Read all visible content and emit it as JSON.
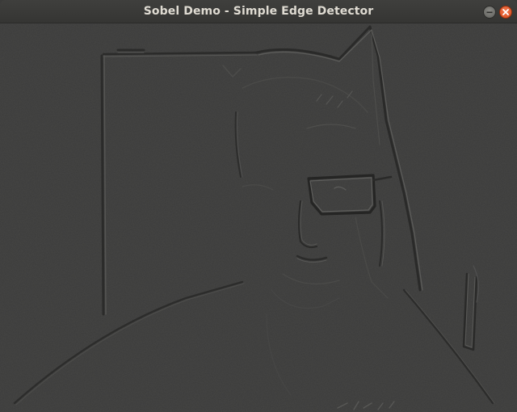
{
  "window": {
    "title": "Sobel Demo - Simple Edge Detector"
  },
  "controls": {
    "minimize_icon": "minimize-icon",
    "close_icon": "close-icon",
    "close_color": "#e2551f"
  },
  "view": {
    "background_color": "#3a3a39",
    "highlight_color": "#5a5a58",
    "shadow_color": "#2a2a29"
  }
}
